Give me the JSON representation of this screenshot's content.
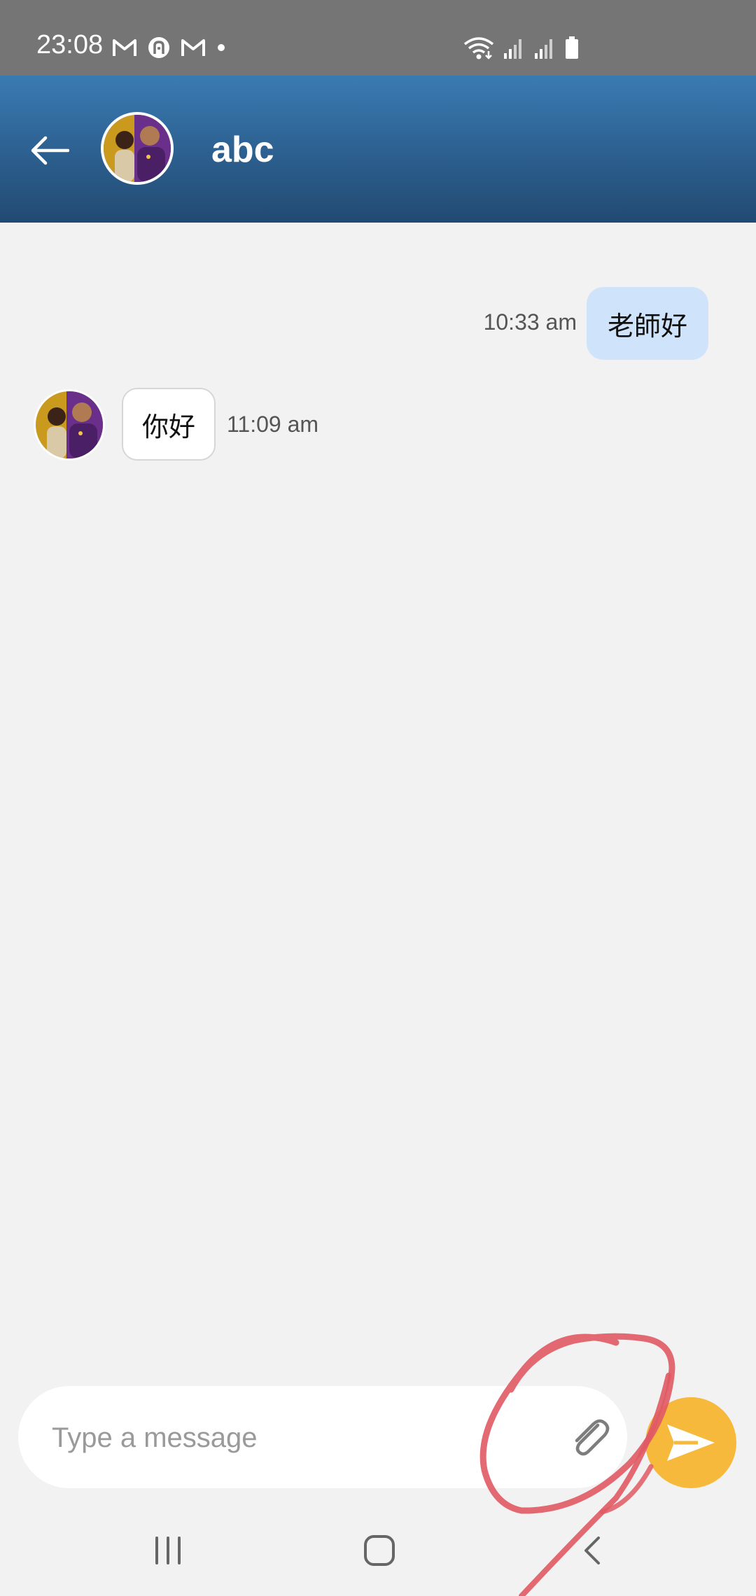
{
  "status_bar": {
    "time": "23:08",
    "left_icons": [
      "gmail-icon",
      "app-notification-icon",
      "gmail-icon",
      "dot-icon"
    ],
    "right_icons": [
      "wifi-icon",
      "signal-icon",
      "signal-icon",
      "battery-icon"
    ]
  },
  "header": {
    "title": "abc",
    "back_icon": "arrow-left-icon",
    "colors": {
      "top": "#3a7bb3",
      "bottom": "#224a72"
    }
  },
  "messages": [
    {
      "direction": "outgoing",
      "text": "老師好",
      "time": "10:33 am",
      "bubble_color": "#cfe3fb"
    },
    {
      "direction": "incoming",
      "text": "你好",
      "time": "11:09 am",
      "bubble_color": "#ffffff"
    }
  ],
  "composer": {
    "placeholder": "Type a message",
    "value": "",
    "attach_icon": "paperclip-icon",
    "send_icon": "send-icon",
    "send_color": "#f6b93b"
  },
  "nav_bar": {
    "items": [
      "recent-apps-icon",
      "home-icon",
      "back-icon"
    ]
  },
  "annotation": {
    "color": "#e05a64",
    "shape": "hand-drawn circle around attach button"
  }
}
